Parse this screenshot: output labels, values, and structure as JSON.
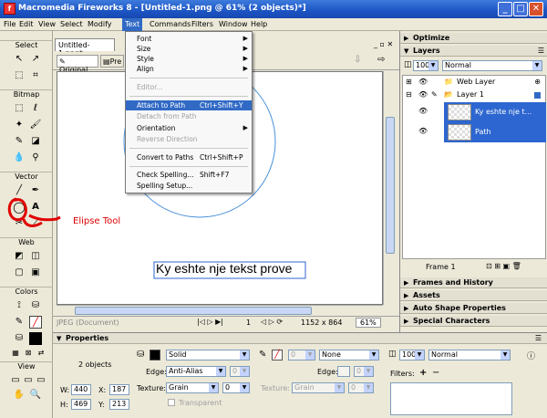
{
  "window": {
    "title": "Macromedia Fireworks 8 - [Untitled-1.png @ 61% (2 objects)*]",
    "minimize": "_",
    "maximize": "□",
    "close": "✕"
  },
  "menubar": [
    "File",
    "Edit",
    "View",
    "Select",
    "Modify",
    "Text",
    "Commands",
    "Filters",
    "Window",
    "Help"
  ],
  "text_menu": {
    "items": [
      {
        "label": "Font",
        "submenu": true,
        "disabled": false
      },
      {
        "label": "Size",
        "submenu": true,
        "disabled": false
      },
      {
        "label": "Style",
        "submenu": true,
        "disabled": false
      },
      {
        "label": "Align",
        "submenu": true,
        "disabled": false
      },
      {
        "label": "Editor...",
        "disabled": true
      },
      {
        "label": "Attach to Path",
        "shortcut": "Ctrl+Shift+Y",
        "highlighted": true
      },
      {
        "label": "Detach from Path",
        "disabled": true
      },
      {
        "label": "Orientation",
        "submenu": true,
        "disabled": false
      },
      {
        "label": "Reverse Direction",
        "disabled": true
      },
      {
        "label": "Convert to Paths",
        "shortcut": "Ctrl+Shift+P",
        "disabled": false
      },
      {
        "label": "Check Spelling...",
        "shortcut": "Shift+F7",
        "disabled": false
      },
      {
        "label": "Spelling Setup...",
        "disabled": false
      }
    ]
  },
  "tools": {
    "select_label": "Select",
    "bitmap_label": "Bitmap",
    "vector_label": "Vector",
    "web_label": "Web",
    "colors_label": "Colors",
    "view_label": "View"
  },
  "annotation": {
    "text": "Elipse Tool",
    "color": "#e00000"
  },
  "document": {
    "tab_name": "Untitled-1.png*",
    "original_label": "Original",
    "preview_label": "Pre",
    "canvas_text": "Ky eshte nje tekst prove",
    "status_format": "JPEG (Document)",
    "page_number": "1",
    "dimensions": "1152 x 864",
    "zoom": "61%"
  },
  "panels": {
    "optimize": "Optimize",
    "layers": "Layers",
    "opacity": "100",
    "blend_mode": "Normal",
    "web_layer": "Web Layer",
    "layer1": "Layer 1",
    "obj1": "Ky eshte nje t...",
    "obj2": "Path",
    "frame": "Frame 1",
    "frames_history": "Frames and History",
    "assets": "Assets",
    "auto_shape": "Auto Shape Properties",
    "special_chars": "Special Characters"
  },
  "properties": {
    "title": "Properties",
    "summary": "2 objects",
    "w_label": "W:",
    "w": "440",
    "x_label": "X:",
    "x": "187",
    "h_label": "H:",
    "h": "469",
    "y_label": "Y:",
    "y": "213",
    "fill_type": "Solid",
    "edge_label": "Edge:",
    "edge": "Anti-Alias",
    "edge_amt": "0",
    "texture_label": "Texture:",
    "texture": "Grain",
    "texture_amt": "0",
    "transparent": "Transparent",
    "stroke_amt": "0",
    "stroke_type": "None",
    "stroke_edge_label": "Edge:",
    "stroke_edge_amt": "0",
    "stroke_texture_label": "Texture:",
    "stroke_texture": "Grain",
    "stroke_texture_amt": "0",
    "opacity": "100",
    "blend": "Normal",
    "filters_label": "Filters:",
    "add": "+",
    "remove": "−"
  },
  "colors": {
    "accent": "#316ac5",
    "selection": "#2d66d0",
    "annotation": "#e00000"
  }
}
